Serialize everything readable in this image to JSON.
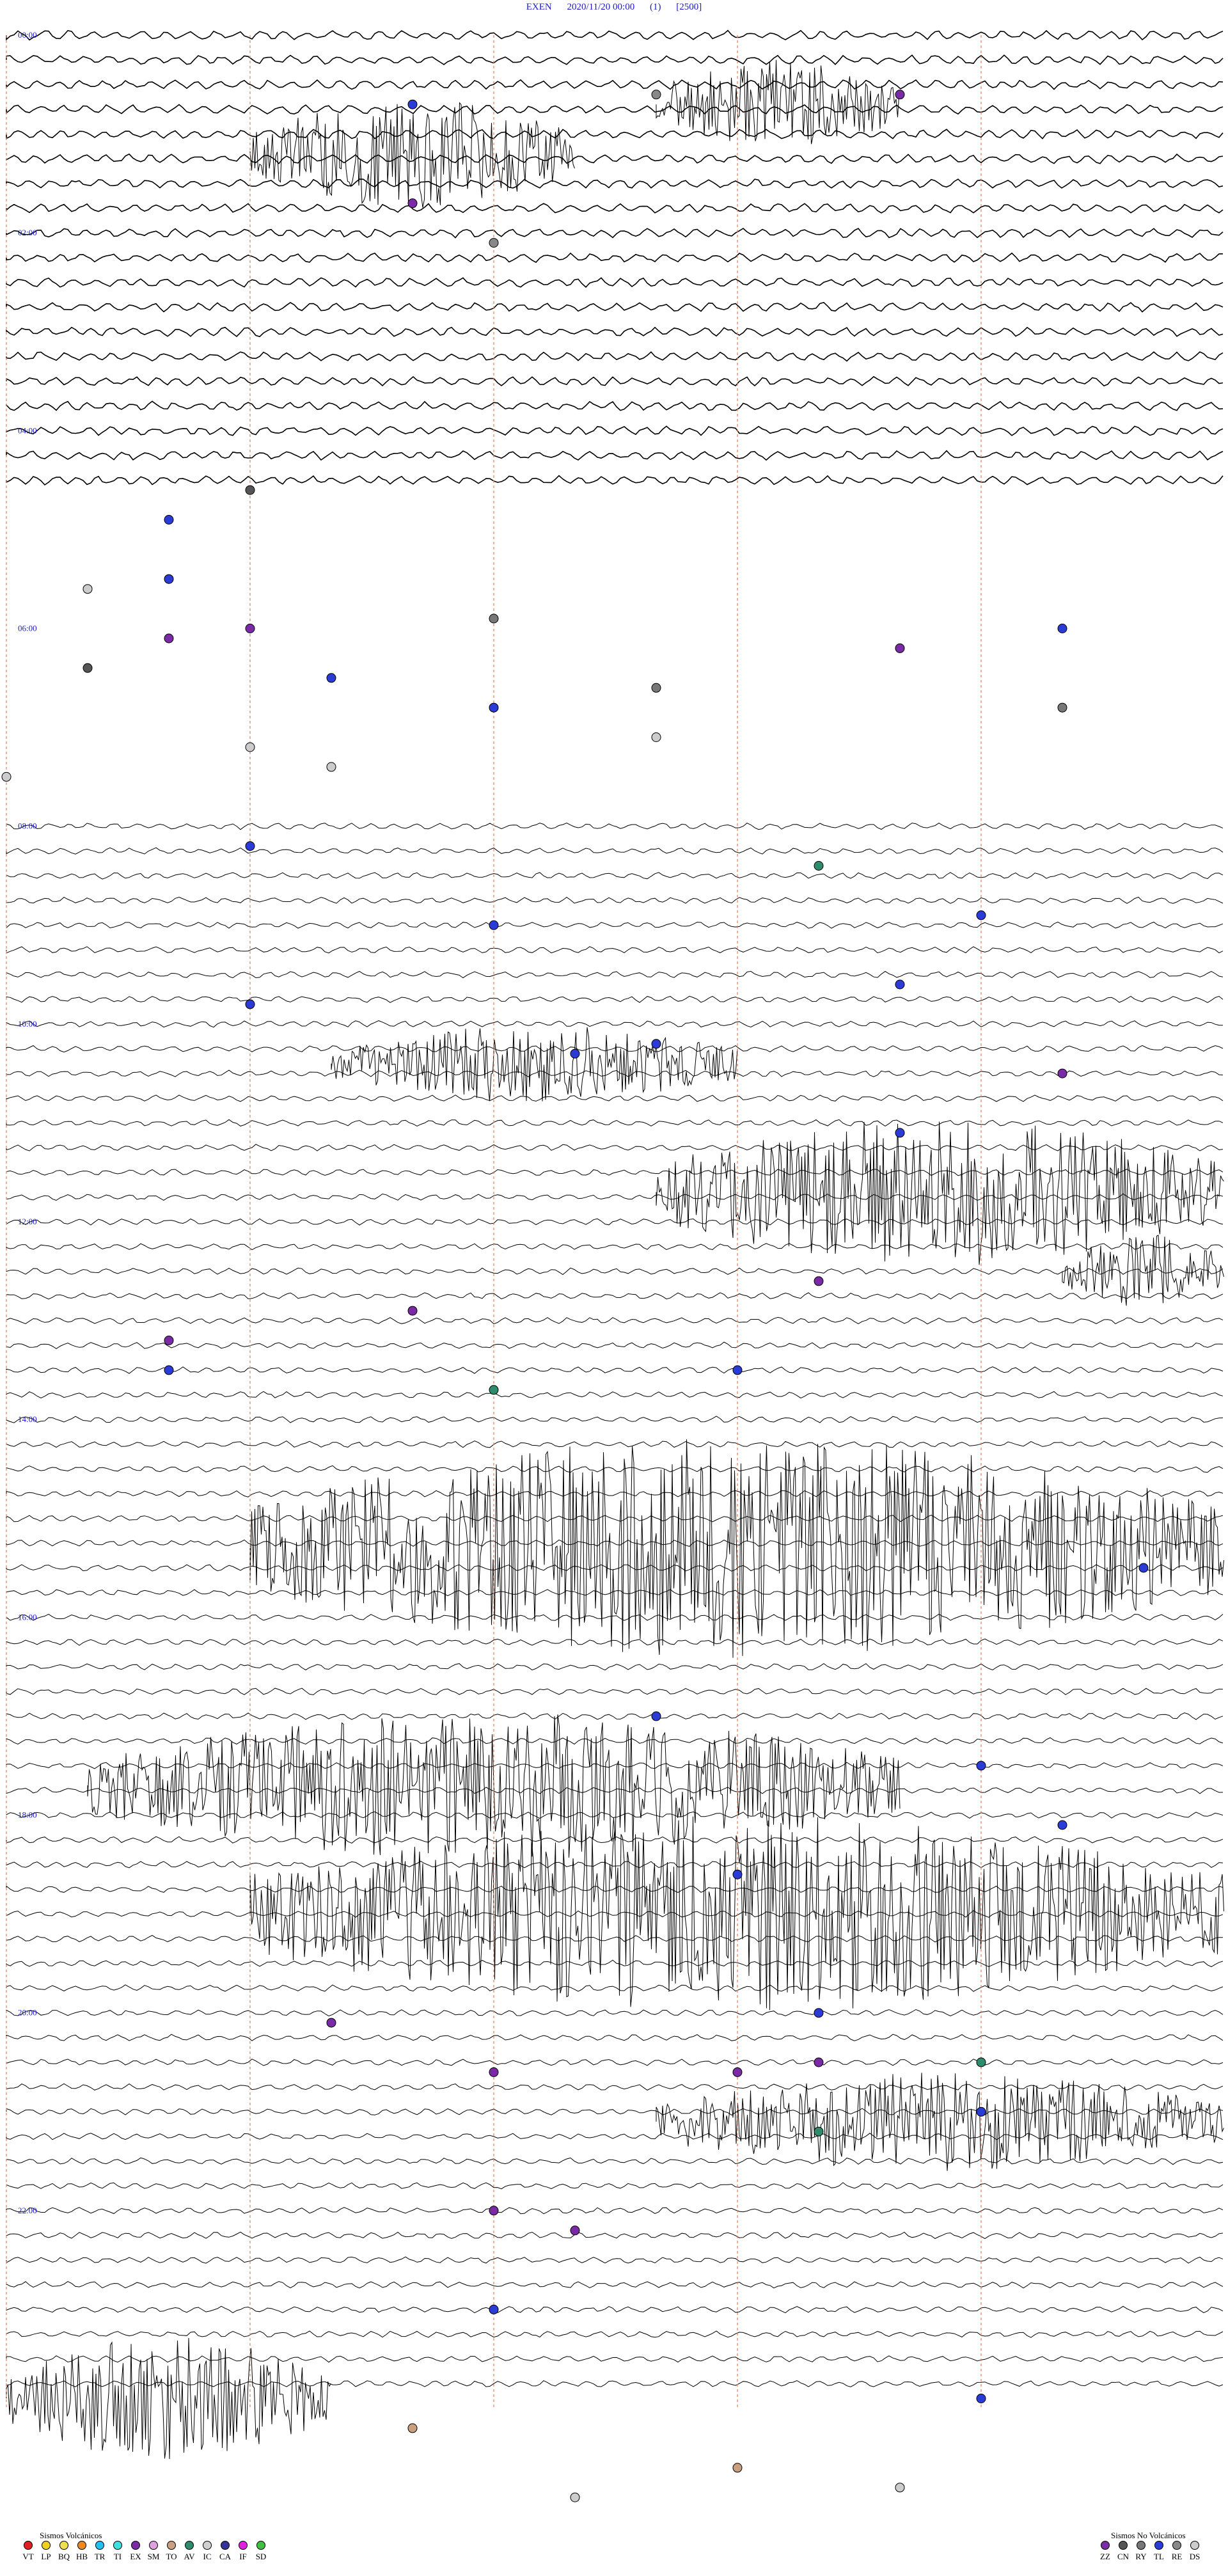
{
  "header": {
    "station": "EXEN",
    "datetime": "2020/11/20 00:00",
    "channel": "(1)",
    "scale": "[2500]"
  },
  "chart_data": {
    "type": "helicorder",
    "hour_labels": [
      "00:00",
      "02:00",
      "04:00",
      "06:00",
      "08:00",
      "10:00",
      "12:00",
      "14:00",
      "16:00",
      "18:00",
      "20:00",
      "22:00"
    ],
    "hour_ticks": [
      0,
      2,
      4,
      6,
      8,
      10,
      12,
      14,
      16,
      18,
      20,
      22
    ],
    "hours": 24,
    "minute_markers": [
      10,
      20,
      30,
      40,
      50
    ],
    "data_gap_hours": [
      4.6,
      8.0
    ],
    "bursts": [
      {
        "hour": 1.2,
        "minute": 3,
        "duration": 4,
        "amp": 2.2
      },
      {
        "hour": 0.7,
        "minute": 53,
        "duration": 3,
        "amp": 1.8
      },
      {
        "hour": 10.4,
        "minute": 34,
        "duration": 5,
        "amp": 1.6
      },
      {
        "hour": 11.7,
        "minute": 53,
        "duration": 12,
        "amp": 3.0
      },
      {
        "hour": 12.5,
        "minute": 13,
        "duration": 5,
        "amp": 1.5
      },
      {
        "hour": 15.3,
        "minute": 18,
        "duration": 22,
        "amp": 4.5
      },
      {
        "hour": 17.7,
        "minute": 1,
        "duration": 10,
        "amp": 3.0
      },
      {
        "hour": 19.0,
        "minute": 3,
        "duration": 55,
        "amp": 4.0
      },
      {
        "hour": 21.1,
        "minute": 53,
        "duration": 12,
        "amp": 2.0
      },
      {
        "hour": 23.9,
        "minute": 0,
        "duration": 4,
        "amp": 2.5
      }
    ],
    "events": [
      {
        "hour": 0.7,
        "minute": 50,
        "color": "#2a3bd6"
      },
      {
        "hour": 0.6,
        "minute": 38,
        "color": "#888888"
      },
      {
        "hour": 0.6,
        "minute": 41,
        "color": "#7b2aa6"
      },
      {
        "hour": 1.7,
        "minute": 20,
        "color": "#7b2aa6"
      },
      {
        "hour": 2.1,
        "minute": 51,
        "color": "#888888"
      },
      {
        "hour": 4.6,
        "minute": 18,
        "color": "#555555"
      },
      {
        "hour": 4.9,
        "minute": 17,
        "color": "#2a3bd6"
      },
      {
        "hour": 5.5,
        "minute": 2,
        "color": "#2a3bd6"
      },
      {
        "hour": 5.6,
        "minute": 31,
        "color": "#cccccc"
      },
      {
        "hour": 5.9,
        "minute": 6,
        "color": "#777777"
      },
      {
        "hour": 6.0,
        "minute": 33,
        "color": "#7b2aa6"
      },
      {
        "hour": 6.1,
        "minute": 47,
        "color": "#7b2aa6"
      },
      {
        "hour": 6.0,
        "minute": 43,
        "color": "#2a3bd6"
      },
      {
        "hour": 6.2,
        "minute": 26,
        "color": "#7b2aa6"
      },
      {
        "hour": 6.4,
        "minute": 1,
        "color": "#555555"
      },
      {
        "hour": 6.5,
        "minute": 4,
        "color": "#2a3bd6"
      },
      {
        "hour": 6.6,
        "minute": 38,
        "color": "#777777"
      },
      {
        "hour": 6.8,
        "minute": 13,
        "color": "#777777"
      },
      {
        "hour": 6.8,
        "minute": 36,
        "color": "#2a3bd6"
      },
      {
        "hour": 7.1,
        "minute": 8,
        "color": "#cccccc"
      },
      {
        "hour": 7.2,
        "minute": 3,
        "color": "#cccccc"
      },
      {
        "hour": 7.4,
        "minute": 34,
        "color": "#cccccc"
      },
      {
        "hour": 7.5,
        "minute": 15,
        "color": "#cccccc"
      },
      {
        "hour": 8.2,
        "minute": 3,
        "color": "#2a3bd6"
      },
      {
        "hour": 8.4,
        "minute": 25,
        "color": "#2e8b6b"
      },
      {
        "hour": 8.9,
        "minute": 27,
        "color": "#2a3bd6"
      },
      {
        "hour": 9.0,
        "minute": 6,
        "color": "#2a3bd6"
      },
      {
        "hour": 9.6,
        "minute": 11,
        "color": "#2a3bd6"
      },
      {
        "hour": 9.8,
        "minute": 3,
        "color": "#2a3bd6"
      },
      {
        "hour": 10.3,
        "minute": 7,
        "color": "#2a3bd6"
      },
      {
        "hour": 10.2,
        "minute": 53,
        "color": "#2a3bd6"
      },
      {
        "hour": 10.5,
        "minute": 43,
        "color": "#7b2aa6"
      },
      {
        "hour": 11.1,
        "minute": 26,
        "color": "#2a3bd6"
      },
      {
        "hour": 12.6,
        "minute": 10,
        "color": "#7b2aa6"
      },
      {
        "hour": 12.9,
        "minute": 20,
        "color": "#7b2aa6"
      },
      {
        "hour": 13.2,
        "minute": 2,
        "color": "#7b2aa6"
      },
      {
        "hour": 13.5,
        "minute": 2,
        "color": "#2a3bd6"
      },
      {
        "hour": 13.7,
        "minute": 6,
        "color": "#2e8b6b"
      },
      {
        "hour": 13.5,
        "minute": 54,
        "color": "#2a3bd6"
      },
      {
        "hour": 15.5,
        "minute": 44,
        "color": "#2a3bd6"
      },
      {
        "hour": 17.0,
        "minute": 8,
        "color": "#2a3bd6"
      },
      {
        "hour": 17.5,
        "minute": 57,
        "color": "#2a3bd6"
      },
      {
        "hour": 18.1,
        "minute": 13,
        "color": "#2a3bd6"
      },
      {
        "hour": 18.6,
        "minute": 39,
        "color": "#2a3bd6"
      },
      {
        "hour": 20.0,
        "minute": 10,
        "color": "#2a3bd6"
      },
      {
        "hour": 20.1,
        "minute": 19,
        "color": "#7b2aa6"
      },
      {
        "hour": 20.5,
        "minute": 25,
        "color": "#7b2aa6"
      },
      {
        "hour": 20.5,
        "minute": 27,
        "color": "#2e8b6b"
      },
      {
        "hour": 20.6,
        "minute": 39,
        "color": "#7b2aa6"
      },
      {
        "hour": 20.6,
        "minute": 51,
        "color": "#7b2aa6"
      },
      {
        "hour": 21.0,
        "minute": 12,
        "color": "#2a3bd6"
      },
      {
        "hour": 21.2,
        "minute": 40,
        "color": "#2e8b6b"
      },
      {
        "hour": 22.0,
        "minute": 21,
        "color": "#7b2aa6"
      },
      {
        "hour": 22.2,
        "minute": 52,
        "color": "#7b2aa6"
      },
      {
        "hour": 23.0,
        "minute": 36,
        "color": "#2a3bd6"
      },
      {
        "hour": 23.9,
        "minute": 57,
        "color": "#2a3bd6"
      },
      {
        "hour": 24.2,
        "minute": 50,
        "color": "#c8a080"
      },
      {
        "hour": 24.6,
        "minute": 54,
        "color": "#c8a080"
      },
      {
        "hour": 24.8,
        "minute": 56,
        "color": "#cccccc"
      },
      {
        "hour": 24.9,
        "minute": 7,
        "color": "#cccccc"
      }
    ],
    "title": "",
    "xlabel": "",
    "ylabel": ""
  },
  "legend_volcanic": {
    "title": "Sismos Volcánicos",
    "items": [
      {
        "code": "VT",
        "color": "#e02020"
      },
      {
        "code": "LP",
        "color": "#f0d020"
      },
      {
        "code": "BQ",
        "color": "#f0e050"
      },
      {
        "code": "HB",
        "color": "#f08820"
      },
      {
        "code": "TR",
        "color": "#20c0f0"
      },
      {
        "code": "TI",
        "color": "#40e0e0"
      },
      {
        "code": "EX",
        "color": "#7b2aa6"
      },
      {
        "code": "SM",
        "color": "#e0a0e0"
      },
      {
        "code": "TO",
        "color": "#c8a080"
      },
      {
        "code": "AV",
        "color": "#2e8b6b"
      },
      {
        "code": "IC",
        "color": "#d0d0d0"
      },
      {
        "code": "CA",
        "color": "#333399"
      },
      {
        "code": "IF",
        "color": "#e020e0"
      },
      {
        "code": "SD",
        "color": "#40c040"
      }
    ]
  },
  "legend_nonvolcanic": {
    "title": "Sismos No Volcánicos",
    "items": [
      {
        "code": "ZZ",
        "color": "#7b2aa6"
      },
      {
        "code": "CN",
        "color": "#555555"
      },
      {
        "code": "RY",
        "color": "#777777"
      },
      {
        "code": "TL",
        "color": "#2a3bd6"
      },
      {
        "code": "RE",
        "color": "#888888"
      },
      {
        "code": "DS",
        "color": "#cccccc"
      }
    ]
  }
}
